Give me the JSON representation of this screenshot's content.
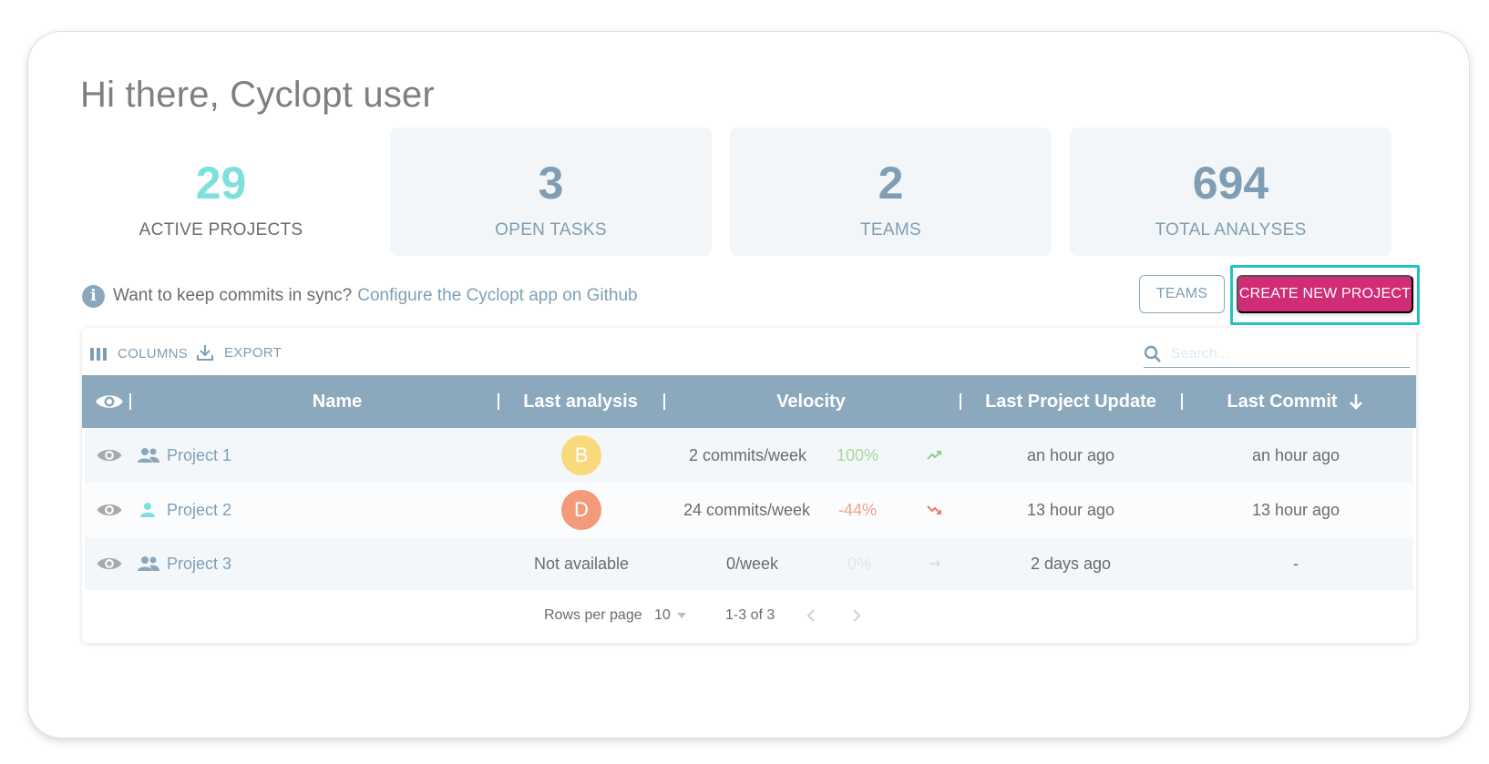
{
  "greeting": "Hi there, Cyclopt user",
  "colors": {
    "accent_teal": "#7ee0dc",
    "stat_blue": "#7f9db3",
    "header_bg": "#8ba8bd",
    "primary_button": "#d12c76",
    "highlight_outline": "#25c2bd",
    "grade_b": "#f8da7d",
    "grade_d": "#f39a7a",
    "positive": "#a6d8a2",
    "negative": "#f2a08a"
  },
  "stats": [
    {
      "value": "29",
      "label": "ACTIVE PROJECTS"
    },
    {
      "value": "3",
      "label": "OPEN TASKS"
    },
    {
      "value": "2",
      "label": "TEAMS"
    },
    {
      "value": "694",
      "label": "TOTAL ANALYSES"
    }
  ],
  "info": {
    "icon": "info-icon",
    "text": "Want to keep commits in sync?",
    "link": "Configure the Cyclopt app on Github"
  },
  "actions": {
    "teams_label": "TEAMS",
    "create_label": "CREATE NEW PROJECT"
  },
  "toolbar": {
    "columns_label": "COLUMNS",
    "export_label": "EXPORT",
    "search_placeholder": "Search..."
  },
  "table": {
    "headers": {
      "name": "Name",
      "last_analysis": "Last analysis",
      "velocity": "Velocity",
      "last_update": "Last Project Update",
      "last_commit": "Last Commit"
    },
    "sort": {
      "column": "last_commit",
      "direction": "descending",
      "icon": "arrow-down-icon"
    },
    "rows": [
      {
        "name": "Project 1",
        "owner_icon": "team-icon",
        "grade": "B",
        "grade_color": "#f8da7d",
        "last_analysis": "",
        "velocity": "2 commits/week",
        "change": "100%",
        "change_color": "#a6d8a2",
        "trend_icon": "trend-up-icon",
        "last_update": "an hour ago",
        "last_commit": "an hour ago"
      },
      {
        "name": "Project 2",
        "owner_icon": "person-icon",
        "grade": "D",
        "grade_color": "#f39a7a",
        "last_analysis": "",
        "velocity": "24 commits/week",
        "change": "-44%",
        "change_color": "#f2a08a",
        "trend_icon": "trend-down-icon",
        "last_update": "13 hour ago",
        "last_commit": "13 hour ago"
      },
      {
        "name": "Project 3",
        "owner_icon": "team-icon",
        "grade": "",
        "grade_color": "",
        "last_analysis": "Not available",
        "velocity": "0/week",
        "change": "0%",
        "change_color": "#e0e6ea",
        "trend_icon": "trend-flat-icon",
        "last_update": "2 days ago",
        "last_commit": "-"
      }
    ]
  },
  "pagination": {
    "rows_per_page_label": "Rows per page",
    "rows_per_page_value": "10",
    "range": "1-3 of 3"
  }
}
